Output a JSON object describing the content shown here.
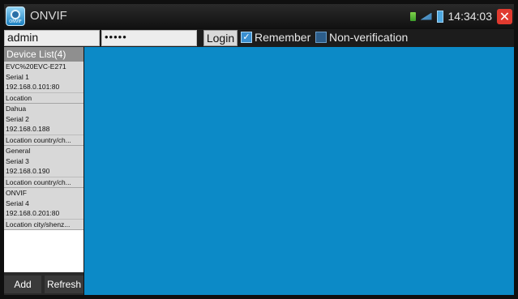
{
  "titlebar": {
    "title": "ONVIF",
    "app_icon_text": "ONVIF",
    "clock": "14:34:03",
    "close_symbol": "✕"
  },
  "login": {
    "username": "admin",
    "password_mask": "•••••",
    "login_label": "Login",
    "remember_label": "Remember",
    "remember_checked": true,
    "nonverification_label": "Non-verification",
    "nonverification_checked": false,
    "check_mark": "✓"
  },
  "device_list": {
    "header": "Device List(4)",
    "devices": [
      {
        "name": "EVC%20EVC-E271",
        "serial": "Serial 1",
        "address": "192.168.0.101:80",
        "location": "Location"
      },
      {
        "name": "Dahua",
        "serial": "Serial 2",
        "address": "192.168.0.188",
        "location": "Location country/ch..."
      },
      {
        "name": "General",
        "serial": "Serial 3",
        "address": "192.168.0.190",
        "location": "Location country/ch..."
      },
      {
        "name": "ONVIF",
        "serial": "Serial 4",
        "address": "192.168.0.201:80",
        "location": "Location city/shenz..."
      }
    ],
    "add_label": "Add",
    "refresh_label": "Refresh"
  },
  "colors": {
    "viewport": "#0c8ac7",
    "titlebar": "#1a1a1a",
    "checkbox_on": "#3a8fd0",
    "close": "#e03a2f"
  }
}
